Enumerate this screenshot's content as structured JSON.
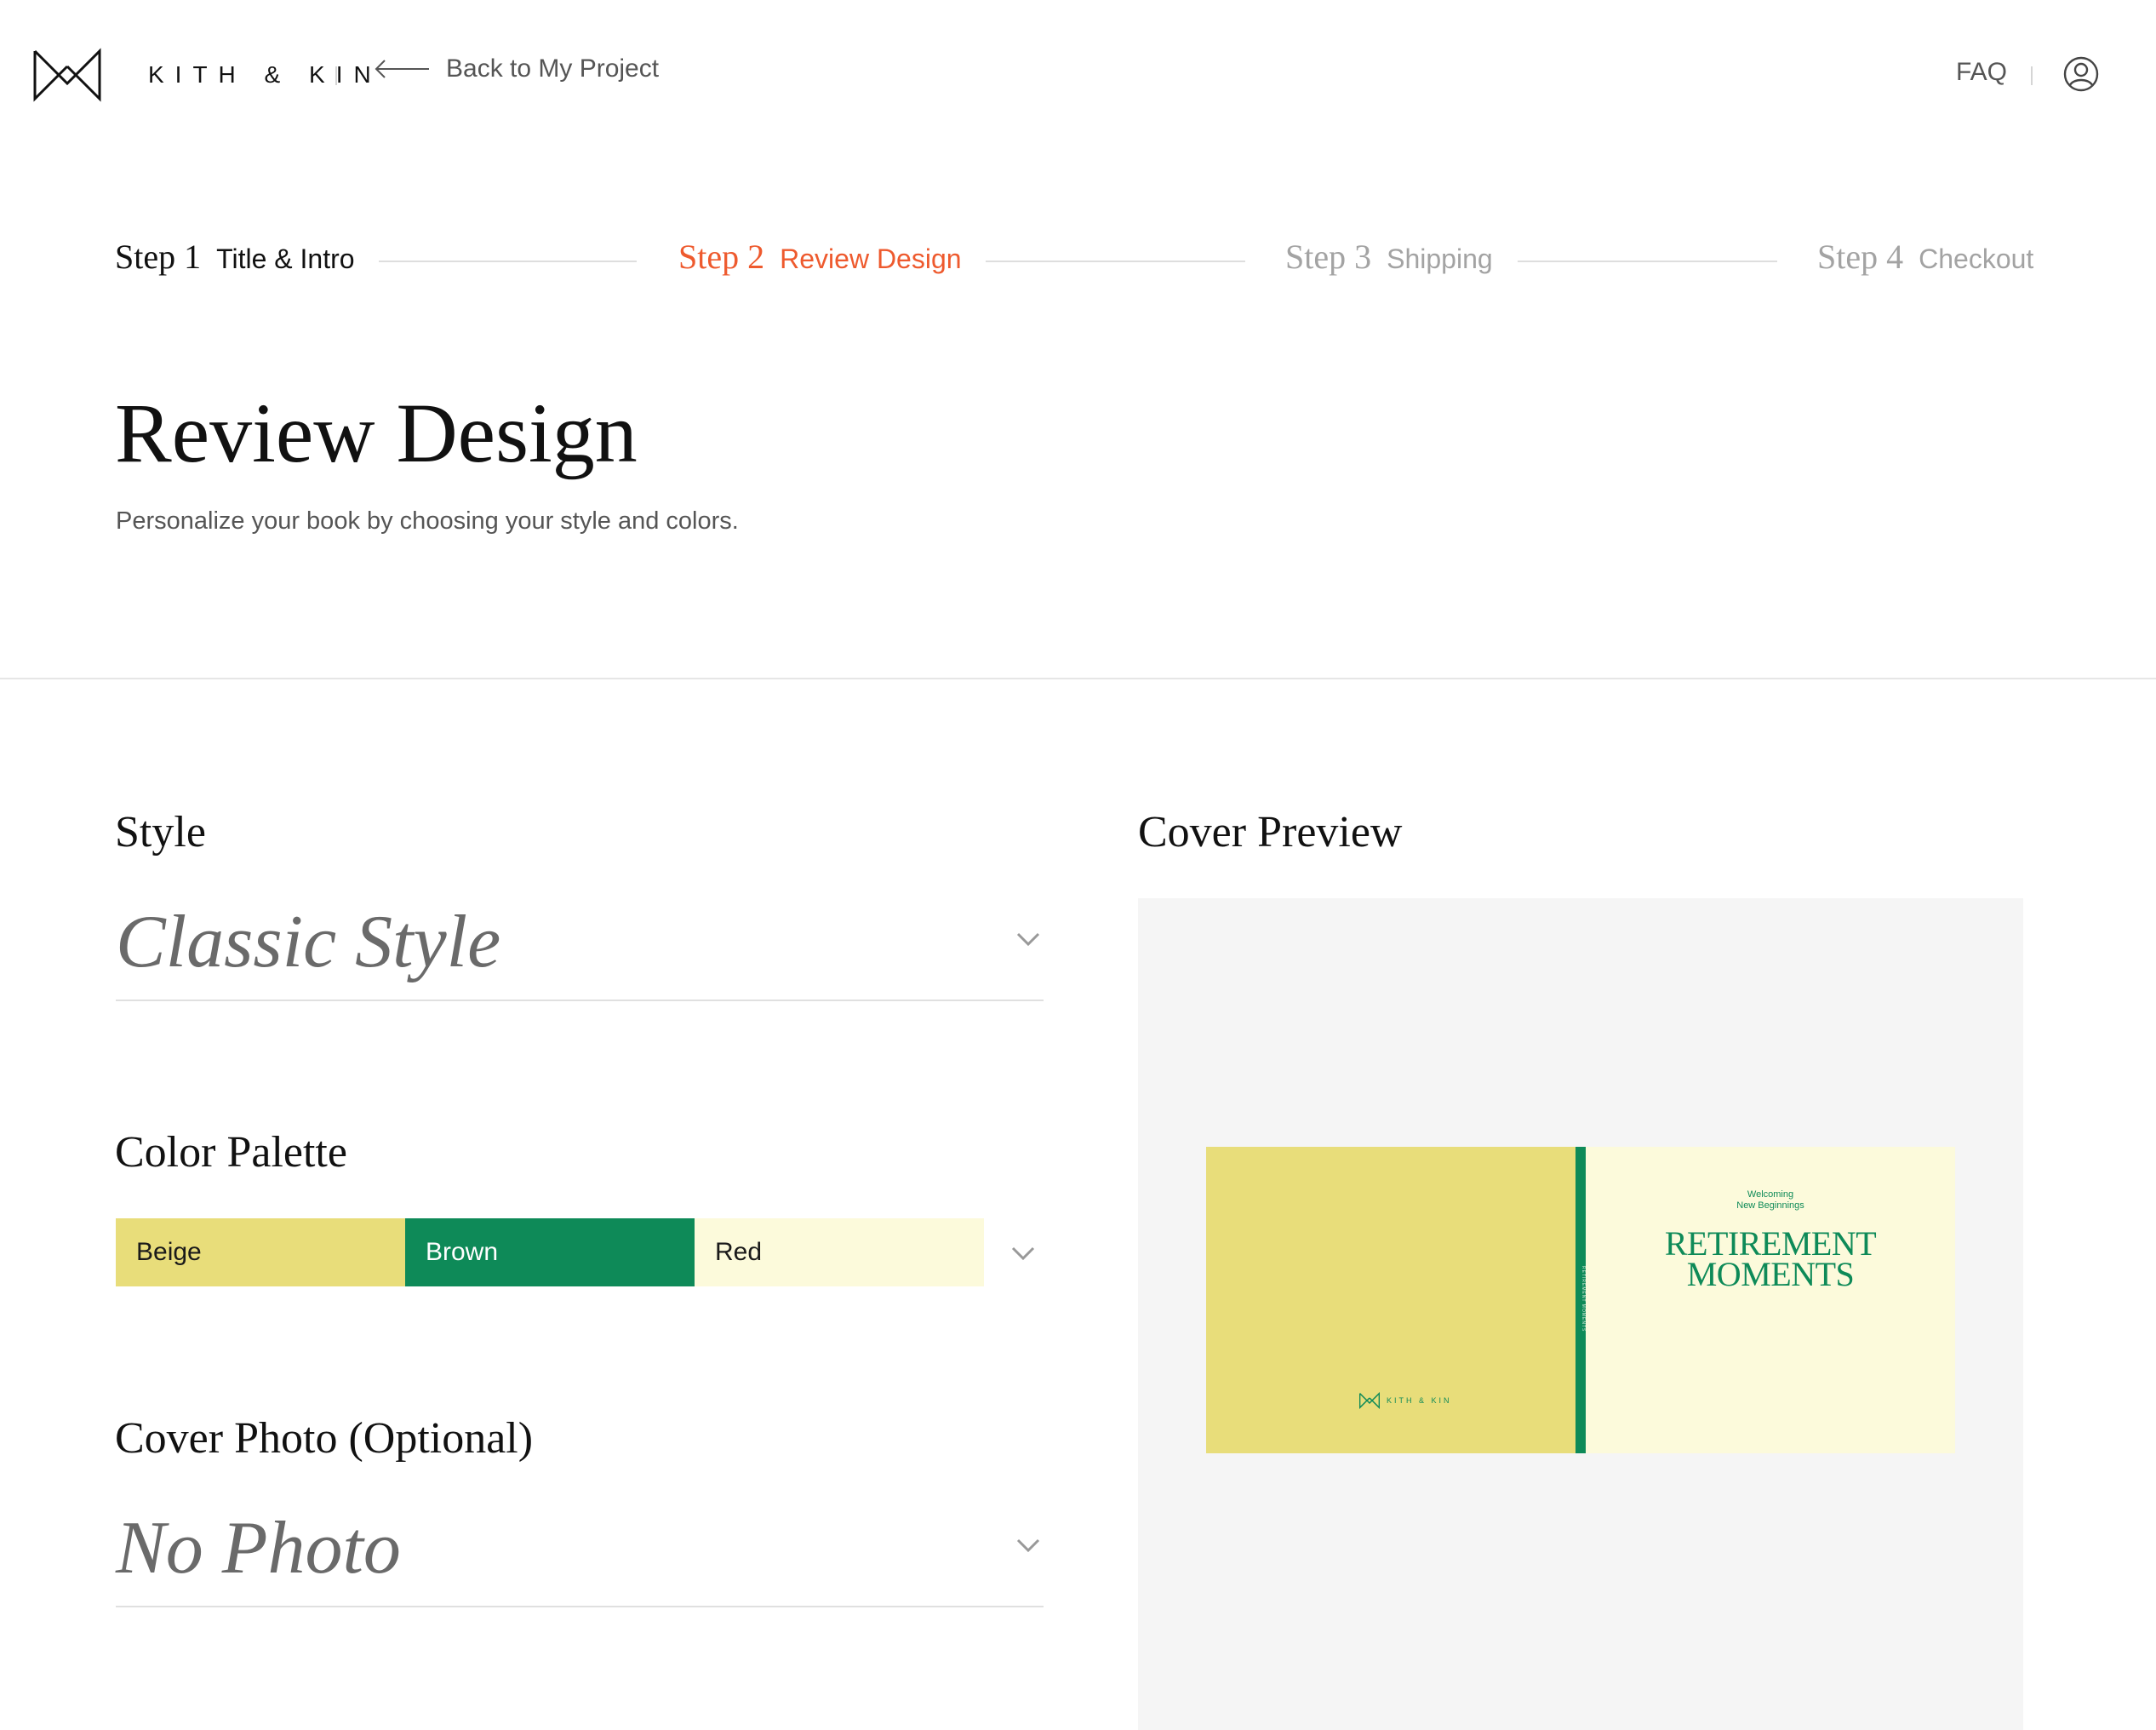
{
  "header": {
    "brand": "KITH & KIN",
    "back_label": "Back to My Project",
    "faq_label": "FAQ"
  },
  "steps": [
    {
      "num": "Step 1",
      "label": "Title & Intro",
      "state": "done"
    },
    {
      "num": "Step 2",
      "label": "Review Design",
      "state": "active"
    },
    {
      "num": "Step 3",
      "label": "Shipping",
      "state": "pending"
    },
    {
      "num": "Step 4",
      "label": "Checkout",
      "state": "pending"
    }
  ],
  "page": {
    "title": "Review Design",
    "subtitle": "Personalize your book by choosing your style and colors."
  },
  "style_section": {
    "label": "Style",
    "value": "Classic Style"
  },
  "palette_section": {
    "label": "Color Palette",
    "swatches": [
      {
        "name": "Beige",
        "color": "#e8dd7a",
        "text_color": "#1a1a1a"
      },
      {
        "name": "Brown",
        "color": "#0e8a58",
        "text_color": "#ffffff"
      },
      {
        "name": "Red",
        "color": "#fcfadb",
        "text_color": "#1a1a1a"
      }
    ]
  },
  "photo_section": {
    "label": "Cover Photo (Optional)",
    "value": "No Photo"
  },
  "preview": {
    "label": "Cover Preview",
    "cover_subtitle_line1": "Welcoming",
    "cover_subtitle_line2": "New Beginnings",
    "cover_title_line1": "RETIREMENT",
    "cover_title_line2": "MOMENTS",
    "spine_text": "RETIREMENT MOMENTS",
    "back_brand": "KITH & KIN"
  },
  "colors": {
    "accent": "#ee5a2e",
    "pending": "#a3a3a3",
    "book_back": "#e8dd7a",
    "book_spine": "#0e8a58",
    "book_front": "#fcfadb",
    "book_ink": "#0e8a58",
    "preview_bg": "#f5f5f5"
  }
}
